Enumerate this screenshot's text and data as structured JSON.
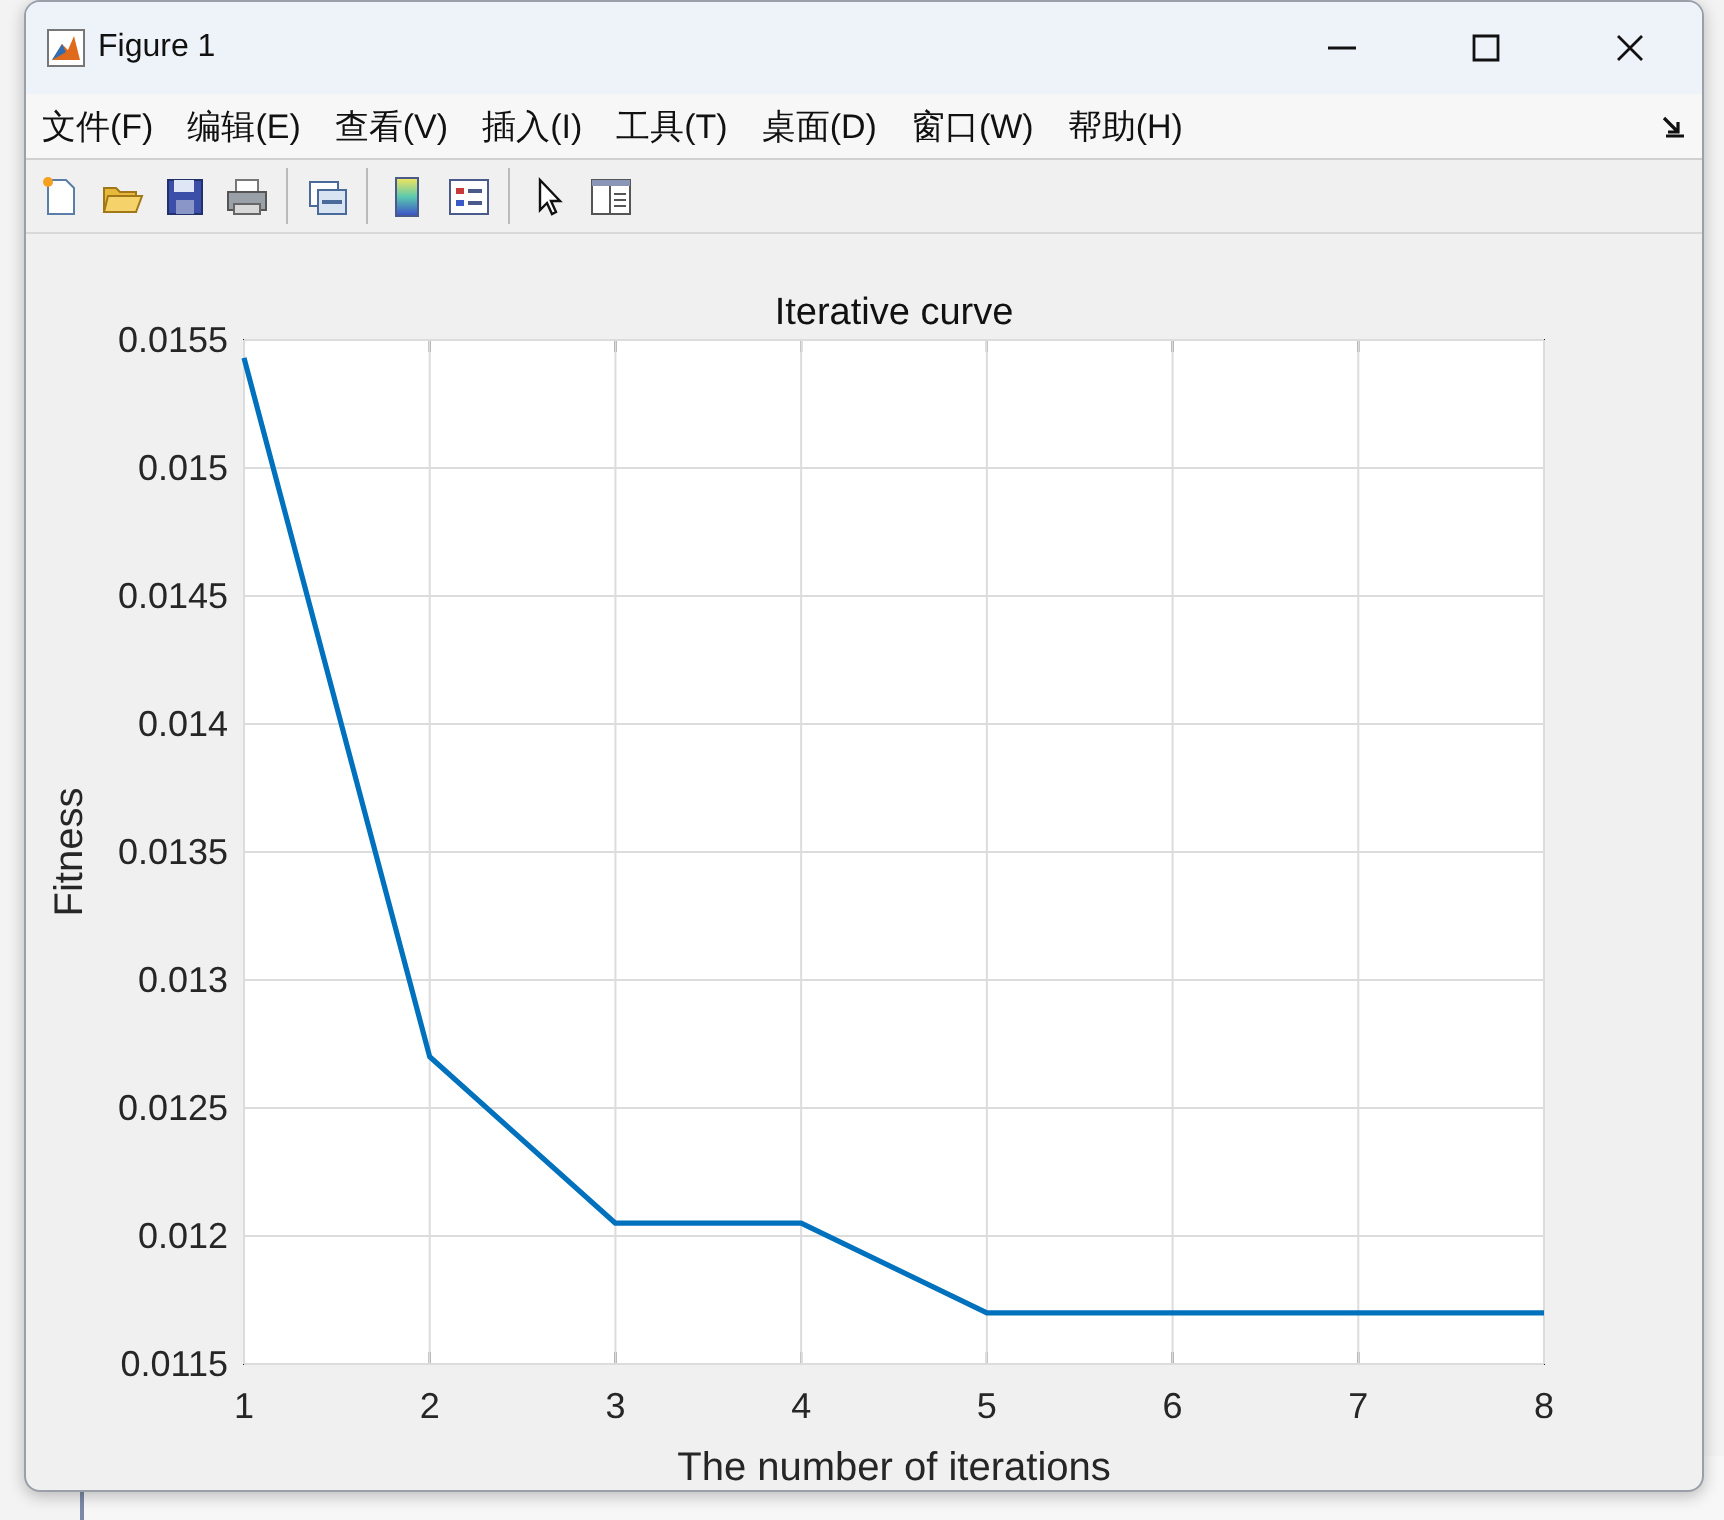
{
  "window": {
    "title": "Figure 1"
  },
  "menu": [
    "文件(F)",
    "编辑(E)",
    "查看(V)",
    "插入(I)",
    "工具(T)",
    "桌面(D)",
    "窗口(W)",
    "帮助(H)"
  ],
  "toolbar": [
    {
      "kind": "new"
    },
    {
      "kind": "open"
    },
    {
      "kind": "save"
    },
    {
      "kind": "print"
    },
    {
      "kind": "separator"
    },
    {
      "kind": "link"
    },
    {
      "kind": "separator"
    },
    {
      "kind": "colorbar"
    },
    {
      "kind": "legend"
    },
    {
      "kind": "separator"
    },
    {
      "kind": "pointer"
    },
    {
      "kind": "property"
    }
  ],
  "chart_data": {
    "type": "line",
    "title": "Iterative curve",
    "xlabel": "The number of iterations",
    "ylabel": "Fitness",
    "x": [
      1,
      2,
      3,
      4,
      5,
      6,
      7,
      8
    ],
    "grid": true,
    "series": [
      {
        "color": "#0072bd",
        "values": [
          0.01543,
          0.0127,
          0.01205,
          0.01205,
          0.0117,
          0.0117,
          0.0117,
          0.0117
        ]
      }
    ],
    "xlim": [
      1,
      8
    ],
    "ylim": [
      0.0115,
      0.0155
    ],
    "xticks": [
      1,
      2,
      3,
      4,
      5,
      6,
      7,
      8
    ],
    "yticks": [
      {
        "value": 0.0115,
        "label": "0.0115"
      },
      {
        "value": 0.012,
        "label": "0.012"
      },
      {
        "value": 0.0125,
        "label": "0.0125"
      },
      {
        "value": 0.013,
        "label": "0.013"
      },
      {
        "value": 0.0135,
        "label": "0.0135"
      },
      {
        "value": 0.014,
        "label": "0.014"
      },
      {
        "value": 0.0145,
        "label": "0.0145"
      },
      {
        "value": 0.015,
        "label": "0.015"
      },
      {
        "value": 0.0155,
        "label": "0.0155"
      }
    ]
  }
}
